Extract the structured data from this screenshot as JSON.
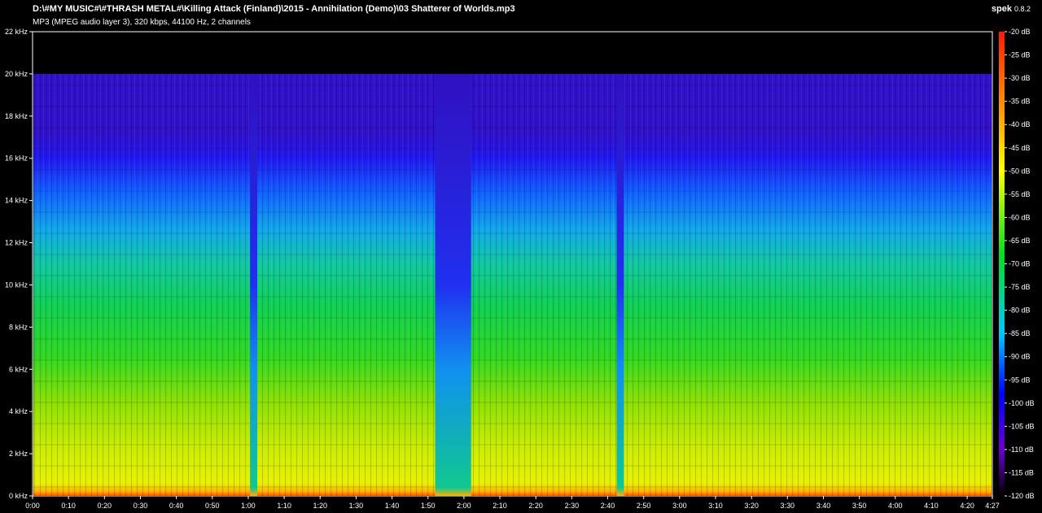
{
  "header": {
    "file_path": "D:\\#MY MUSIC#\\#THRASH METAL#\\Killing Attack (Finland)\\2015 - Annihilation (Demo)\\03 Shatterer of Worlds.mp3",
    "file_info": "MP3 (MPEG audio layer 3), 320 kbps, 44100 Hz, 2 channels",
    "app_name": "spek",
    "app_version": "0.8.2"
  },
  "chart_data": {
    "type": "heatmap",
    "title": "D:\\#MY MUSIC#\\#THRASH METAL#\\Killing Attack (Finland)\\2015 - Annihilation (Demo)\\03 Shatterer of Worlds.mp3",
    "subtitle": "MP3 (MPEG audio layer 3), 320 kbps, 44100 Hz, 2 channels",
    "x_axis": {
      "range_seconds": [
        0,
        267
      ],
      "tick_seconds": [
        0,
        10,
        20,
        30,
        40,
        50,
        60,
        70,
        80,
        90,
        100,
        110,
        120,
        130,
        140,
        150,
        160,
        170,
        180,
        190,
        200,
        210,
        220,
        230,
        240,
        250,
        260
      ],
      "tick_labels": [
        "0:00",
        "0:10",
        "0:20",
        "0:30",
        "0:40",
        "0:50",
        "1:00",
        "1:10",
        "1:20",
        "1:30",
        "1:40",
        "1:50",
        "2:00",
        "2:10",
        "2:20",
        "2:30",
        "2:40",
        "2:50",
        "3:00",
        "3:10",
        "3:20",
        "3:30",
        "3:40",
        "3:50",
        "4:00",
        "4:10",
        "4:20"
      ],
      "end_label": "4:27"
    },
    "y_axis": {
      "range_khz": [
        0,
        22
      ],
      "tick_khz": [
        0,
        2,
        4,
        6,
        8,
        10,
        12,
        14,
        16,
        18,
        20,
        22
      ],
      "tick_labels": [
        "0 kHz",
        "2 kHz",
        "4 kHz",
        "6 kHz",
        "8 kHz",
        "10 kHz",
        "12 kHz",
        "14 kHz",
        "16 kHz",
        "18 kHz",
        "20 kHz",
        "22 kHz"
      ],
      "spectral_cutoff_khz": 20
    },
    "color_scale": {
      "range_db": [
        -120,
        -20
      ],
      "tick_db": [
        -20,
        -25,
        -30,
        -35,
        -40,
        -45,
        -50,
        -55,
        -60,
        -65,
        -70,
        -75,
        -80,
        -85,
        -90,
        -95,
        -100,
        -105,
        -110,
        -115,
        -120
      ],
      "tick_labels": [
        "-20 dB",
        "-25 dB",
        "-30 dB",
        "-35 dB",
        "-40 dB",
        "-45 dB",
        "-50 dB",
        "-55 dB",
        "-60 dB",
        "-65 dB",
        "-70 dB",
        "-75 dB",
        "-80 dB",
        "-85 dB",
        "-90 dB",
        "-95 dB",
        "-100 dB",
        "-105 dB",
        "-110 dB",
        "-115 dB",
        "-120 dB"
      ],
      "colors": [
        "#ff1a00",
        "#ff8c00",
        "#ffff00",
        "#00e020",
        "#00c8ff",
        "#0000ff",
        "#6a00d0",
        "#000000"
      ]
    },
    "quiet_segments_seconds": [
      [
        60.5,
        62.5
      ],
      [
        112,
        122
      ],
      [
        162.5,
        164
      ],
      [
        163,
        164.5
      ]
    ]
  }
}
